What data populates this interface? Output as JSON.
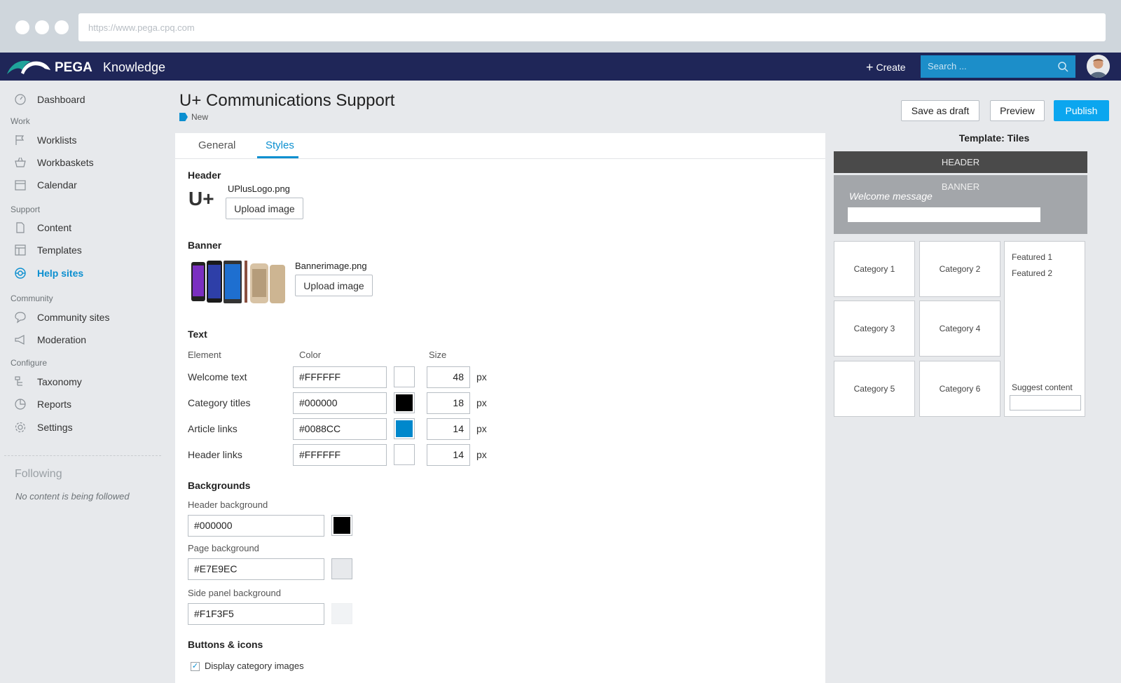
{
  "browser": {
    "url": "https://www.pega.cpq.com"
  },
  "topnav": {
    "brand": "Knowledge",
    "create_label": "Create",
    "search_placeholder": "Search ..."
  },
  "sidebar": {
    "items": [
      {
        "label": "Dashboard",
        "icon": "dashboard-icon"
      },
      {
        "section": "Work"
      },
      {
        "label": "Worklists",
        "icon": "flag-icon"
      },
      {
        "label": "Workbaskets",
        "icon": "basket-icon"
      },
      {
        "label": "Calendar",
        "icon": "calendar-icon"
      },
      {
        "section": "Support"
      },
      {
        "label": "Content",
        "icon": "document-icon"
      },
      {
        "label": "Templates",
        "icon": "template-icon"
      },
      {
        "label": "Help sites",
        "icon": "lifebuoy-icon",
        "active": true
      },
      {
        "section": "Community"
      },
      {
        "label": "Community sites",
        "icon": "chat-icon"
      },
      {
        "label": "Moderation",
        "icon": "megaphone-icon"
      },
      {
        "section": "Configure"
      },
      {
        "label": "Taxonomy",
        "icon": "hierarchy-icon"
      },
      {
        "label": "Reports",
        "icon": "chart-icon"
      },
      {
        "label": "Settings",
        "icon": "gear-icon"
      }
    ],
    "following_title": "Following",
    "following_empty": "No content is being followed"
  },
  "page": {
    "title": "U+ Communications Support",
    "status": "New",
    "actions": {
      "save_draft": "Save as draft",
      "preview": "Preview",
      "publish": "Publish"
    }
  },
  "tabs": [
    "General",
    "Styles"
  ],
  "styles": {
    "header": {
      "heading": "Header",
      "logo_text": "U+",
      "filename": "UPlusLogo.png",
      "upload_label": "Upload image"
    },
    "banner": {
      "heading": "Banner",
      "filename": "Bannerimage.png",
      "upload_label": "Upload image"
    },
    "text": {
      "heading": "Text",
      "col_element": "Element",
      "col_color": "Color",
      "col_size": "Size",
      "unit": "px",
      "rows": [
        {
          "element": "Welcome text",
          "color": "#FFFFFF",
          "size": "48"
        },
        {
          "element": "Category titles",
          "color": "#000000",
          "size": "18"
        },
        {
          "element": "Article links",
          "color": "#0088CC",
          "size": "14"
        },
        {
          "element": "Header links",
          "color": "#FFFFFF",
          "size": "14"
        }
      ]
    },
    "backgrounds": {
      "heading": "Backgrounds",
      "items": [
        {
          "label": "Header background",
          "color": "#000000"
        },
        {
          "label": "Page background",
          "color": "#E7E9EC"
        },
        {
          "label": "Side panel background",
          "color": "#F1F3F5"
        }
      ]
    },
    "buttons": {
      "heading": "Buttons & icons",
      "display_category_images": "Display category images",
      "display_category_images_checked": true
    }
  },
  "preview": {
    "title": "Template: Tiles",
    "header": "HEADER",
    "banner": "BANNER",
    "welcome": "Welcome message",
    "categories": [
      "Category 1",
      "Category 2",
      "Category 3",
      "Category 4",
      "Category 5",
      "Category 6"
    ],
    "featured": [
      "Featured 1",
      "Featured 2"
    ],
    "suggest": "Suggest content"
  },
  "colors": {
    "nav_bg": "#1f2658",
    "accent": "#0b8fd0",
    "publish": "#0ba6ef"
  }
}
